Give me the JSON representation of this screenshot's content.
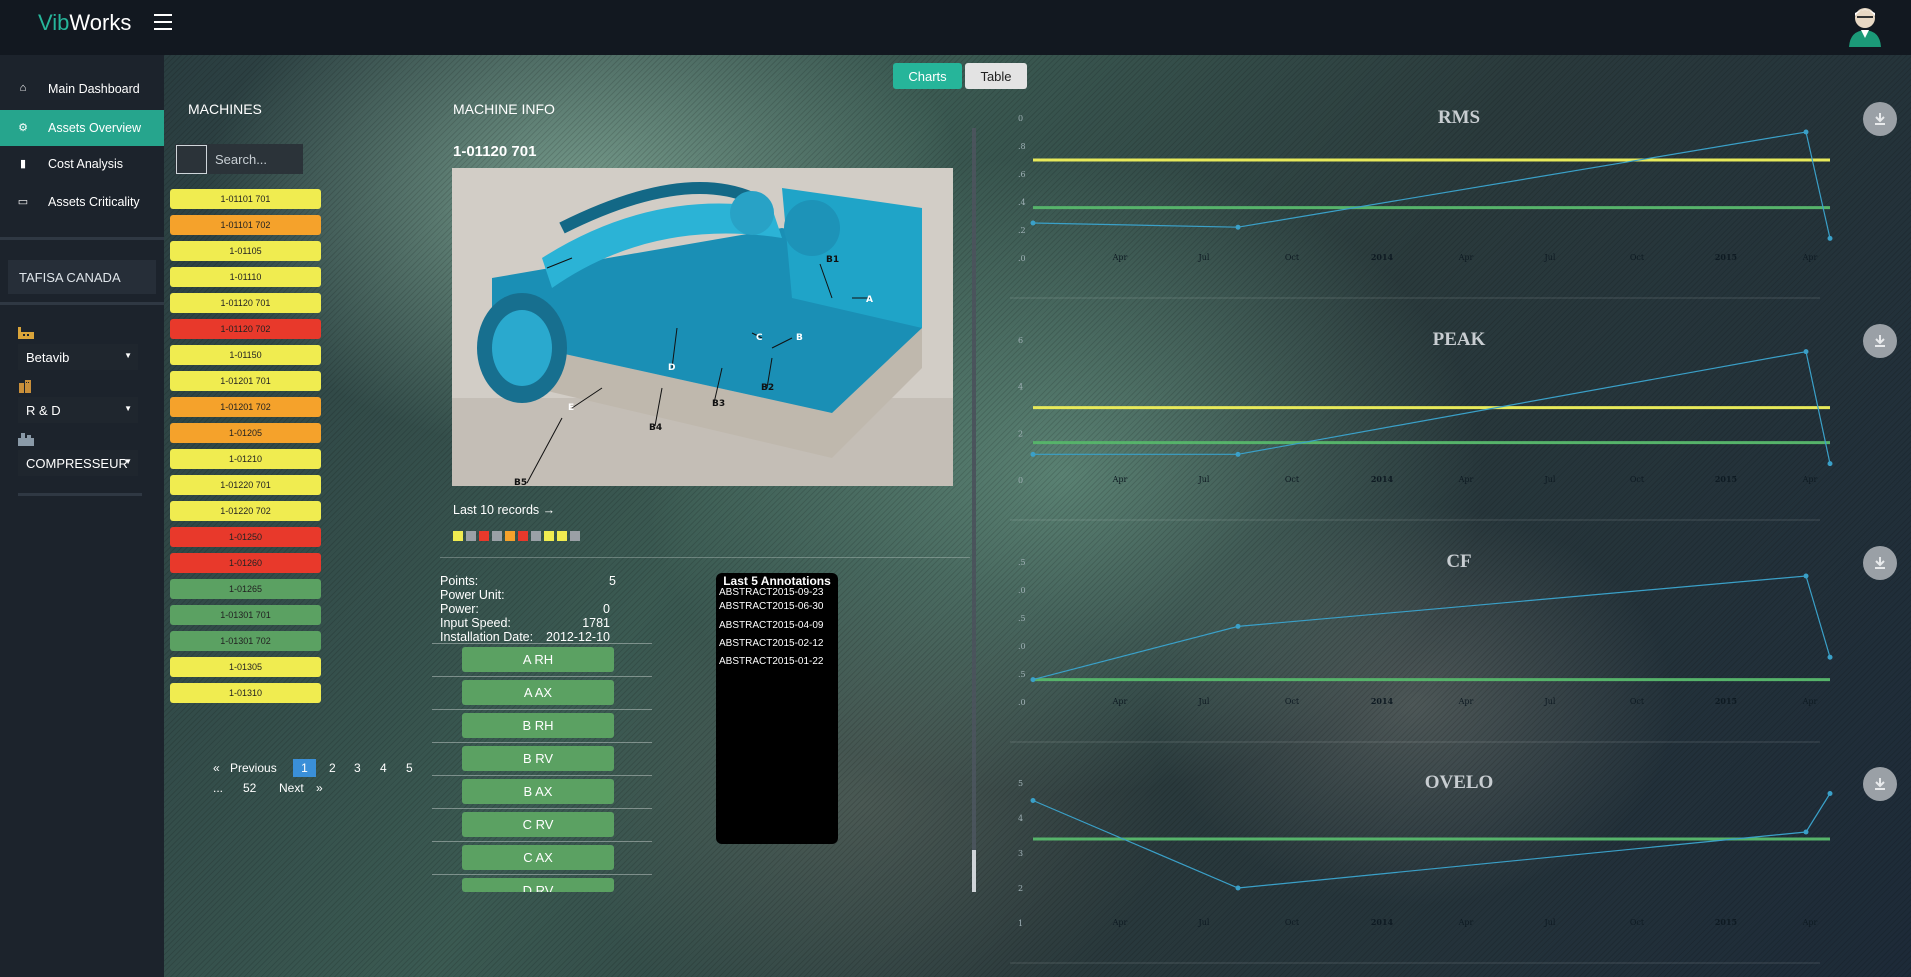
{
  "app": {
    "brand_a": "Vib",
    "brand_b": "Works"
  },
  "nav": [
    {
      "label": "Main Dashboard",
      "icon": "home-icon"
    },
    {
      "label": "Assets Overview",
      "icon": "gear-icon"
    },
    {
      "label": "Cost Analysis",
      "icon": "bar-chart-icon"
    },
    {
      "label": "Assets Criticality",
      "icon": "monitor-icon"
    }
  ],
  "company": "TAFISA CANADA",
  "selects": {
    "site": "Betavib",
    "department": "R & D",
    "machine_type": "COMPRESSEUR"
  },
  "view_toggle": {
    "charts": "Charts",
    "table": "Table"
  },
  "machines": {
    "title": "MACHINES",
    "search_placeholder": "Search...",
    "items": [
      {
        "name": "1-01101 701",
        "status": "yellow"
      },
      {
        "name": "1-01101 702",
        "status": "orange"
      },
      {
        "name": "1-01105",
        "status": "yellow"
      },
      {
        "name": "1-01110",
        "status": "yellow"
      },
      {
        "name": "1-01120 701",
        "status": "yellow"
      },
      {
        "name": "1-01120 702",
        "status": "red"
      },
      {
        "name": "1-01150",
        "status": "yellow"
      },
      {
        "name": "1-01201 701",
        "status": "yellow"
      },
      {
        "name": "1-01201 702",
        "status": "orange"
      },
      {
        "name": "1-01205",
        "status": "orange"
      },
      {
        "name": "1-01210",
        "status": "yellow"
      },
      {
        "name": "1-01220 701",
        "status": "yellow"
      },
      {
        "name": "1-01220 702",
        "status": "yellow"
      },
      {
        "name": "1-01250",
        "status": "red"
      },
      {
        "name": "1-01260",
        "status": "red"
      },
      {
        "name": "1-01265",
        "status": "green"
      },
      {
        "name": "1-01301 701",
        "status": "green"
      },
      {
        "name": "1-01301 702",
        "status": "green"
      },
      {
        "name": "1-01305",
        "status": "yellow"
      },
      {
        "name": "1-01310",
        "status": "yellow"
      }
    ],
    "pagination": {
      "prev_arrow": "«",
      "previous": "Previous",
      "pages": [
        "1",
        "2",
        "3",
        "4",
        "5"
      ],
      "ellipsis": "...",
      "last": "52",
      "next": "Next",
      "next_arrow": "»"
    }
  },
  "machine_info": {
    "title": "MACHINE INFO",
    "machine_name": "1-01120 701",
    "last_records_label": "Last 10 records →",
    "last_records_colors": [
      "#f0ec50",
      "#9aa0a6",
      "#e8392b",
      "#9aa0a6",
      "#f5a22b",
      "#e8392b",
      "#9aa0a6",
      "#f0ec50",
      "#f0ec50",
      "#9aa0a6"
    ],
    "image_labels": [
      "B1",
      "A",
      "B",
      "C",
      "D",
      "E",
      "B2",
      "B3",
      "B4",
      "B5"
    ],
    "fields": [
      {
        "label": "Points:",
        "value": "5"
      },
      {
        "label": "Power Unit:",
        "value": ""
      },
      {
        "label": "Power:",
        "value": "0"
      },
      {
        "label": "Input Speed:",
        "value": "1781"
      },
      {
        "label": "Installation Date:",
        "value": "2012-12-10"
      }
    ],
    "points": [
      "A RH",
      "A AX",
      "B RH",
      "B RV",
      "B AX",
      "C RV",
      "C AX",
      "D RV"
    ],
    "annotations_title": "Last 5 Annotations",
    "annotations": [
      "ABSTRACT2015-09-23",
      "ABSTRACT2015-06-30",
      "ABSTRACT2015-04-09",
      "ABSTRACT2015-02-12",
      "ABSTRACT2015-01-22"
    ]
  },
  "chart_data": [
    {
      "type": "line",
      "title": "RMS",
      "x_ticks": [
        "Apr",
        "Jul",
        "Oct",
        "2014",
        "Apr",
        "Jul",
        "Oct",
        "2015",
        "Apr"
      ],
      "y_ticks": [
        ".0",
        ".2",
        ".4",
        ".6",
        ".8",
        "0"
      ],
      "ylim": [
        0,
        1
      ],
      "series_values": [
        0.25,
        0.22,
        0.9,
        0.14
      ],
      "thresholds": [
        {
          "value": 0.7,
          "color": "#e7e95a"
        },
        {
          "value": 0.36,
          "color": "#56b36a"
        }
      ],
      "line_color": "#3aa0c8"
    },
    {
      "type": "line",
      "title": "PEAK",
      "x_ticks": [
        "Apr",
        "Jul",
        "Oct",
        "2014",
        "Apr",
        "Jul",
        "Oct",
        "2015",
        "Apr"
      ],
      "y_ticks": [
        "0",
        "2",
        "4",
        "6"
      ],
      "ylim": [
        0,
        6
      ],
      "series_values": [
        1.1,
        1.1,
        5.5,
        0.7
      ],
      "thresholds": [
        {
          "value": 3.1,
          "color": "#e7e95a"
        },
        {
          "value": 1.6,
          "color": "#56b36a"
        }
      ],
      "line_color": "#3aa0c8"
    },
    {
      "type": "line",
      "title": "CF",
      "x_ticks": [
        "Apr",
        "Jul",
        "Oct",
        "2014",
        "Apr",
        "Jul",
        "Oct",
        "2015",
        "Apr"
      ],
      "y_ticks": [
        ".0",
        ".5",
        ".0",
        ".5",
        ".0",
        ".5"
      ],
      "ylim": [
        0,
        5
      ],
      "series_values": [
        0.8,
        2.7,
        4.5,
        1.6
      ],
      "thresholds": [
        {
          "value": 0.8,
          "color": "#56b36a"
        }
      ],
      "line_color": "#3aa0c8"
    },
    {
      "type": "line",
      "title": "OVELO",
      "x_ticks": [
        "Apr",
        "Jul",
        "Oct",
        "2014",
        "Apr",
        "Jul",
        "Oct",
        "2015",
        "Apr"
      ],
      "y_ticks": [
        "1",
        "2",
        "3",
        "4",
        "5"
      ],
      "ylim": [
        1,
        5
      ],
      "series_values": [
        4.5,
        2.0,
        3.6,
        4.7
      ],
      "thresholds": [
        {
          "value": 3.4,
          "color": "#56b36a"
        }
      ],
      "line_color": "#3aa0c8"
    }
  ]
}
